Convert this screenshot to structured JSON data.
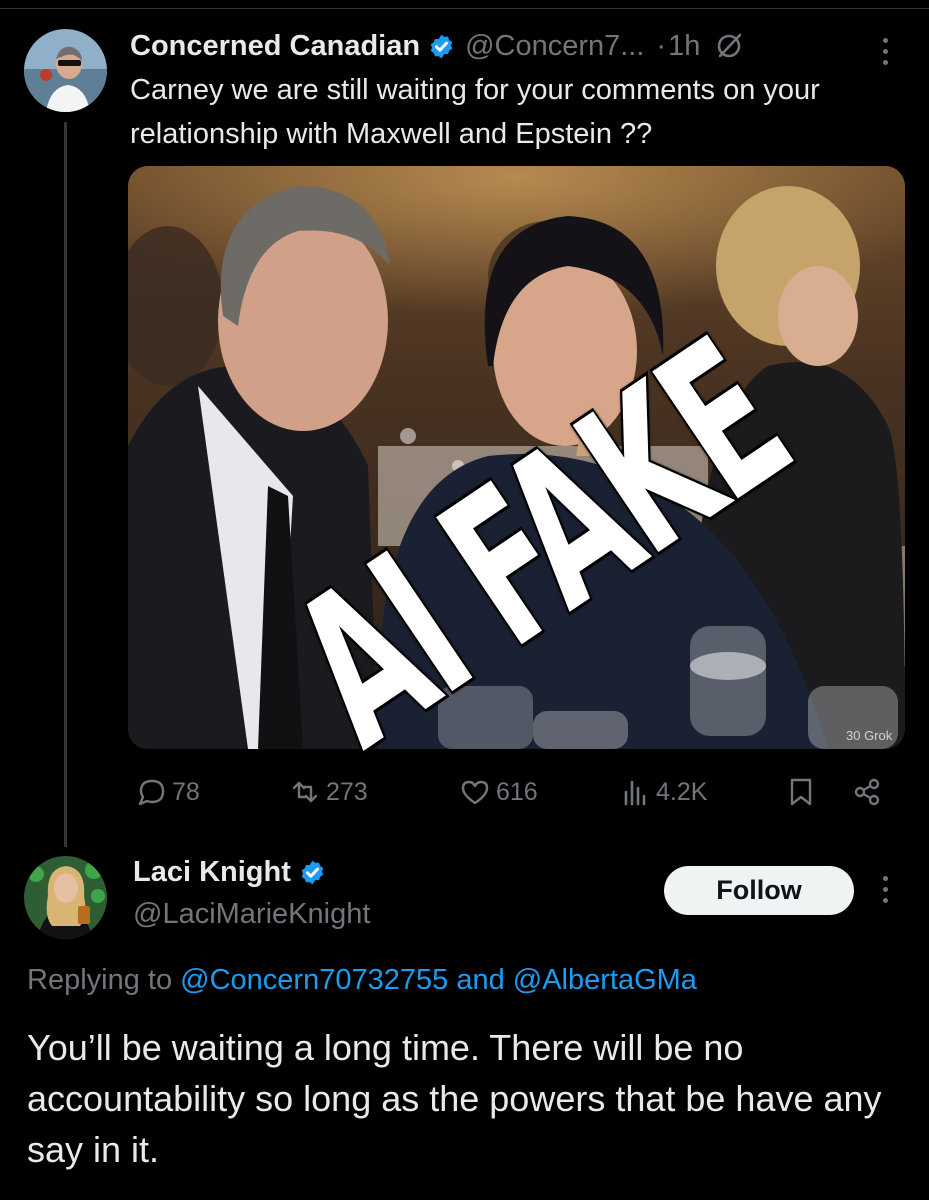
{
  "tweet": {
    "author_name": "Concerned Canadian",
    "author_handle": "@Concern7...",
    "separator": "·",
    "time": "1h",
    "text": "Carney we are still waiting for your comments on your relationship with Maxwell and Epstein ??",
    "overlay_stamp": "AI FAKE",
    "photo_watermark": "30 Grok",
    "stats": {
      "replies": "78",
      "reposts": "273",
      "likes": "616",
      "views": "4.2K"
    }
  },
  "reply": {
    "author_name": "Laci Knight",
    "author_handle": "@LaciMarieKnight",
    "follow_label": "Follow",
    "replying_prefix": "Replying to",
    "replying_user1": "@Concern70732755",
    "replying_and": "and",
    "replying_user2": "@AlbertaGMa",
    "text": "You’ll be waiting a long time. There will be no accountability so long as the powers that be have any say in it."
  },
  "colors": {
    "background": "#000000",
    "text": "#e7e9ea",
    "muted": "#71767b",
    "accent": "#1d9bf0",
    "follow_bg": "#eff3f4"
  },
  "icons": [
    "verified-badge-icon",
    "grok-icon",
    "more-icon",
    "reply-icon",
    "repost-icon",
    "like-icon",
    "views-icon",
    "bookmark-icon",
    "share-icon"
  ]
}
